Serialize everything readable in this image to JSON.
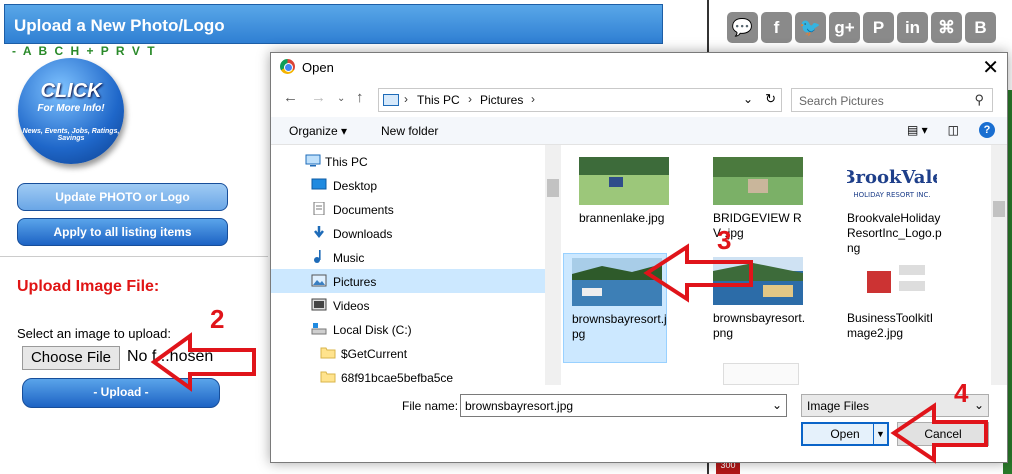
{
  "page": {
    "header_title": "Upload a New Photo/Logo",
    "alpha_nav": "- A B C H + P R V T",
    "click_ball": {
      "big": "CLICK",
      "sub": "For More Info!",
      "tiny": "News, Events, Jobs, Ratings, Savings"
    },
    "update_btn": "Update PHOTO or Logo",
    "apply_btn": "Apply to all listing items",
    "upload_label": "Upload Image File:",
    "select_label": "Select an image to upload:",
    "choose_file": "Choose File",
    "no_file": "No f...hosen",
    "upload_btn": "- Upload -",
    "social": [
      "💬",
      "f",
      "🐦",
      "g+",
      "P",
      "in",
      "⌘",
      "B"
    ],
    "badge": "300"
  },
  "dialog": {
    "title": "Open",
    "breadcrumb": [
      "This PC",
      "Pictures"
    ],
    "search_placeholder": "Search Pictures",
    "organize": "Organize ▾",
    "new_folder": "New folder",
    "tree": [
      {
        "label": "This PC",
        "icon": "pc"
      },
      {
        "label": "Desktop",
        "icon": "desktop"
      },
      {
        "label": "Documents",
        "icon": "documents"
      },
      {
        "label": "Downloads",
        "icon": "downloads"
      },
      {
        "label": "Music",
        "icon": "music"
      },
      {
        "label": "Pictures",
        "icon": "pictures"
      },
      {
        "label": "Videos",
        "icon": "videos"
      },
      {
        "label": "Local Disk (C:)",
        "icon": "disk"
      },
      {
        "label": "$GetCurrent",
        "icon": "folder"
      },
      {
        "label": "68f91bcae5befba5ce",
        "icon": "folder"
      }
    ],
    "files": [
      {
        "name": "brannenlake.jpg"
      },
      {
        "name": "BRIDGEVIEW RV .jpg"
      },
      {
        "name": "BrookvaleHolidayResortInc_Logo.png"
      },
      {
        "name": "brownsbayresort.jpg"
      },
      {
        "name": "brownsbayresort.png"
      },
      {
        "name": "BusinessToolkitImage2.jpg"
      }
    ],
    "logo_text": {
      "main": "BrookVale",
      "sub": "HOLIDAY RESORT INC."
    },
    "filename_label": "File name:",
    "filename_value": "brownsbayresort.jpg",
    "filetype": "Image Files",
    "open_btn": "Open",
    "cancel_btn": "Cancel"
  },
  "annotations": {
    "n2": "2",
    "n3": "3",
    "n4": "4"
  }
}
